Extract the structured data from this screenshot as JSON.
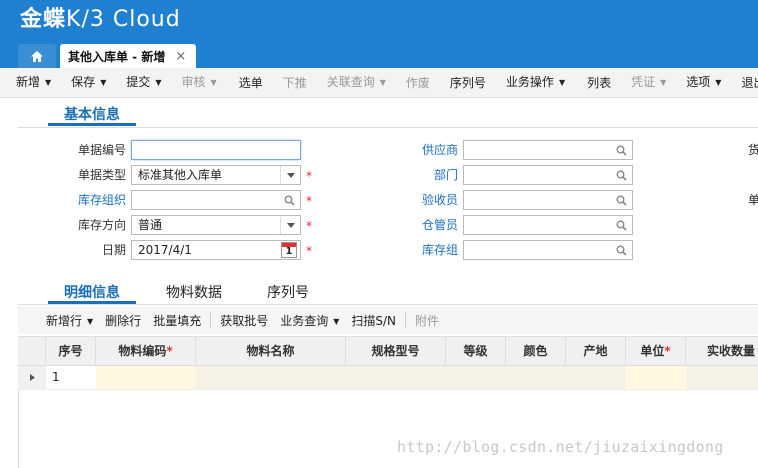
{
  "app": {
    "logo_cn": "金蝶",
    "logo_en": "K/3 Cloud"
  },
  "tabs": {
    "home_icon": "home-icon",
    "active_label": "其他入库单 - 新增",
    "close": "×"
  },
  "toolbar": [
    {
      "label": "新增",
      "dropdown": true,
      "disabled": false
    },
    {
      "label": "保存",
      "dropdown": true,
      "disabled": false
    },
    {
      "label": "提交",
      "dropdown": true,
      "disabled": false
    },
    {
      "label": "审核",
      "dropdown": true,
      "disabled": true
    },
    {
      "sep": true
    },
    {
      "label": "选单",
      "dropdown": false,
      "disabled": false
    },
    {
      "label": "下推",
      "dropdown": false,
      "disabled": true
    },
    {
      "label": "关联查询",
      "dropdown": true,
      "disabled": true
    },
    {
      "label": "作废",
      "dropdown": false,
      "disabled": true
    },
    {
      "label": "序列号",
      "dropdown": false,
      "disabled": false
    },
    {
      "label": "业务操作",
      "dropdown": true,
      "disabled": false
    },
    {
      "sep": true
    },
    {
      "label": "列表",
      "dropdown": false,
      "disabled": false
    },
    {
      "label": "凭证",
      "dropdown": true,
      "disabled": true
    },
    {
      "label": "选项",
      "dropdown": true,
      "disabled": false
    },
    {
      "label": "退出",
      "dropdown": false,
      "disabled": false
    }
  ],
  "sections": {
    "basic": "基本信息",
    "detail": "明细信息",
    "material_data": "物料数据",
    "serial": "序列号"
  },
  "form": {
    "bill_no_label": "单据编号",
    "bill_no_value": "",
    "bill_type_label": "单据类型",
    "bill_type_value": "标准其他入库单",
    "stock_org_label": "库存组织",
    "stock_org_value": "",
    "direction_label": "库存方向",
    "direction_value": "普通",
    "date_label": "日期",
    "date_value": "2017/4/1",
    "calendar_day": "1",
    "supplier_label": "供应商",
    "supplier_value": "",
    "dept_label": "部门",
    "dept_value": "",
    "inspector_label": "验收员",
    "inspector_value": "",
    "keeper_label": "仓管员",
    "keeper_value": "",
    "stock_group_label": "库存组",
    "stock_group_value": "",
    "right_cut_1": "货",
    "right_cut_2": "单",
    "required_mark": "*"
  },
  "grid_toolbar": [
    {
      "label": "新增行",
      "dropdown": true,
      "disabled": false
    },
    {
      "label": "删除行",
      "dropdown": false,
      "disabled": false
    },
    {
      "label": "批量填充",
      "dropdown": false,
      "disabled": false
    },
    {
      "sep": true
    },
    {
      "label": "获取批号",
      "dropdown": false,
      "disabled": false
    },
    {
      "label": "业务查询",
      "dropdown": true,
      "disabled": false
    },
    {
      "label": "扫描S/N",
      "dropdown": false,
      "disabled": false
    },
    {
      "sep": true
    },
    {
      "label": "附件",
      "dropdown": false,
      "disabled": true
    }
  ],
  "grid_columns": {
    "seq": "序号",
    "material_code": "物料编码",
    "material_name": "物料名称",
    "spec": "规格型号",
    "grade": "等级",
    "color": "颜色",
    "origin": "产地",
    "unit": "单位",
    "qty": "实收数量"
  },
  "grid_rows": [
    {
      "seq": "1"
    }
  ],
  "watermark": "http://blog.csdn.net/jiuzaixingdong"
}
